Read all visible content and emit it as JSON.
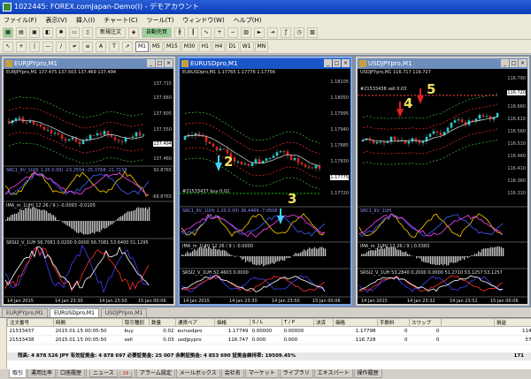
{
  "window": {
    "title": "1022445: FOREX.comJapan-Demo(I) - デモアカウント"
  },
  "menu": [
    "ファイル(F)",
    "表示(V)",
    "挿入(I)",
    "チャート(C)",
    "ツール(T)",
    "ウィンドウ(W)",
    "ヘルプ(H)"
  ],
  "toolbar": {
    "new_order": "新規注文",
    "auto_trade": "自動売買",
    "timeframes": [
      "M1",
      "M5",
      "M15",
      "M30",
      "H1",
      "H4",
      "D1",
      "W1",
      "MN"
    ],
    "active_timeframe": "M1"
  },
  "charts": [
    {
      "title": "EURJPYpro,M1",
      "header": "EURJPYpro,M1  137.475 137.503 137.469 137.494",
      "prices": [
        "137.715",
        "137.660",
        "137.605",
        "137.550",
        "137.494",
        "137.460"
      ],
      "last_price": "137.494",
      "sub1": "SRC1_IIV_1UH( 1.20 0.00) -23.2554 -25.3768 -21.7158",
      "sub1_scale": [
        "92.8765",
        "-68.8765"
      ],
      "sub2": "IMA_m_1UH( 12 26 / 9 ) -0.0093 -0.0105",
      "sub3": "SRSI2_V_1UH 56.7081 0.0200 0.0000 56.7081 53.6400 51.1295",
      "times": [
        "14 Jan 2015",
        "14 Jan 23:30",
        "14 Jan 23:50",
        "15 Jan 00:06"
      ]
    },
    {
      "title": "EURUSDpro,M1",
      "header": "EURUSDpro,M1  1.17765 1.17776 1.17756",
      "prices": [
        "1.18105",
        "1.18050",
        "1.17995",
        "1.17940",
        "1.17885",
        "1.17830",
        "1.17775",
        "1.17720"
      ],
      "order_line": "#21533437 buy 0.02",
      "sub1": "SRC1_IIV_1UH( 1.20 0.00) 36.4466 -7.0508",
      "sub2": "IMA_m_1UH( 12 26 / 9 ) -0.0000",
      "sub3": "SRSI2_V_1UH 52.4603 0.0000",
      "times": [
        "14 Jan 2015",
        "14 Jan 23:30",
        "14 Jan 23:50",
        "15 Jan 00:06"
      ],
      "arrow_labels": [
        "2",
        "3"
      ]
    },
    {
      "title": "USDJPYpro,M1",
      "header": "USDJPYpro,M1  116.717 116.727",
      "prices": [
        "116.790",
        "116.720",
        "116.660",
        "116.610",
        "116.560",
        "116.510",
        "116.460",
        "116.410",
        "116.360",
        "116.310"
      ],
      "order_line": "#21533438 sell 0.03",
      "sub1": "SRC1_IIV_1UH",
      "sub2": "IMA_m_1UH( 12 26 / 9 ) 0.0383",
      "sub3": "SRSI2_V_1UH 53.2840 0.2000 0.0000 51.2710 53.1257 53.1257",
      "times": [
        "14 Jan 2015",
        "14 Jan 23:32",
        "14 Jan 23:52",
        "15 Jan 00:06"
      ],
      "arrow_labels": [
        "4",
        "5"
      ]
    }
  ],
  "chart_tabs": [
    "EURJPYpro,M1",
    "EURUSDpro,M1",
    "USDJPYpro,M1"
  ],
  "active_chart_tab": "EURUSDpro,M1",
  "trades": {
    "headers": [
      "注文番号",
      "時間",
      "取引種別",
      "数量",
      "通貨ペア",
      "価格",
      "S / L",
      "T / P",
      "決済",
      "価格",
      "手数料",
      "スワップ",
      "",
      "損益"
    ],
    "rows": [
      [
        "21533437",
        "2015.01.15 00:05:50",
        "buy",
        "0.02",
        "eurusdpro",
        "1.17749",
        "0.00000",
        "0.00000",
        "",
        "1.17798",
        "0",
        "0",
        "",
        "114"
      ],
      [
        "21533438",
        "2015.01.15 00:05:50",
        "sell",
        "0.03",
        "usdjpypro",
        "116.747",
        "0.000",
        "0.000",
        "",
        "116.728",
        "0",
        "0",
        "",
        "57"
      ]
    ]
  },
  "balance_line": "残高: 4 878 526 JPY  有効証拠金: 4 878 697  必要証拠金: 25 007  余剰証拠金: 4 853 690  証拠金維持率: 19509.45%",
  "balance_total": "171",
  "terminal_tabs": [
    "取引",
    "運用比率",
    "口座履歴",
    "ニュース",
    "アラーム設定",
    "メールボックス",
    "会社名",
    "マーケット",
    "ライブラリ",
    "エキスパート",
    "操作履歴"
  ],
  "news_count": "29"
}
